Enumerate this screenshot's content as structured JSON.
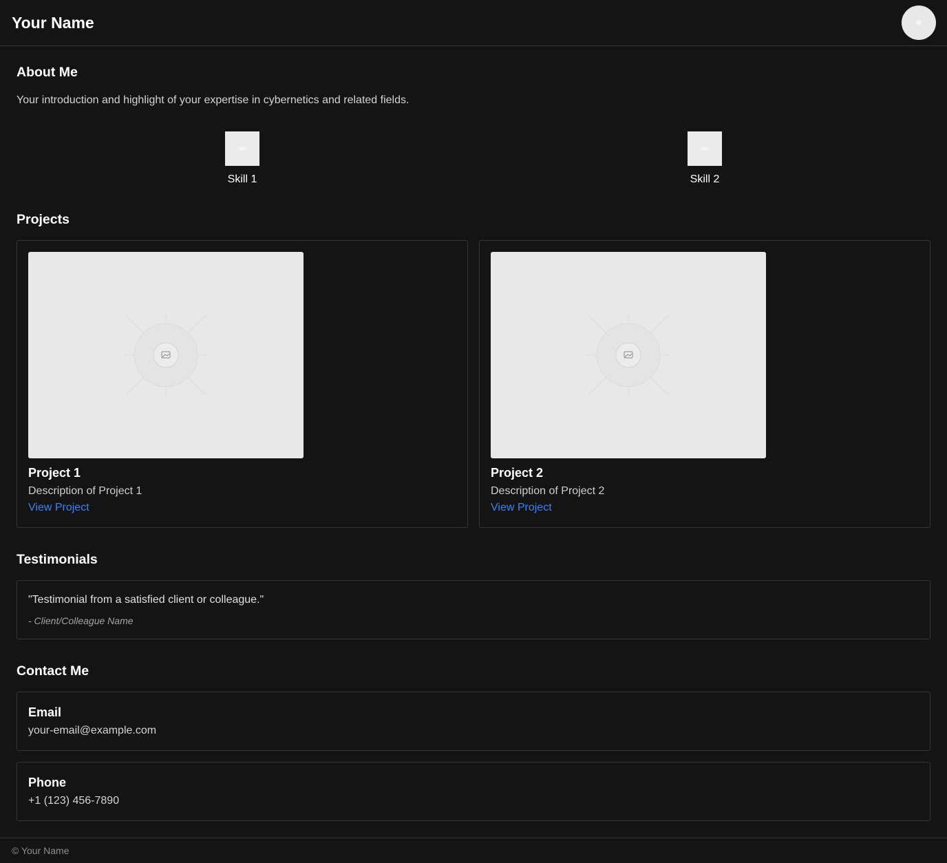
{
  "header": {
    "title": "Your Name"
  },
  "about": {
    "heading": "About Me",
    "text": "Your introduction and highlight of your expertise in cybernetics and related fields.",
    "skills": [
      {
        "label": "Skill 1"
      },
      {
        "label": "Skill 2"
      }
    ]
  },
  "projects": {
    "heading": "Projects",
    "items": [
      {
        "title": "Project 1",
        "description": "Description of Project 1",
        "link_label": "View Project"
      },
      {
        "title": "Project 2",
        "description": "Description of Project 2",
        "link_label": "View Project"
      }
    ]
  },
  "testimonials": {
    "heading": "Testimonials",
    "quote": "\"Testimonial from a satisfied client or colleague.\"",
    "author": "- Client/Colleague Name"
  },
  "contact": {
    "heading": "Contact Me",
    "email": {
      "label": "Email",
      "value": "your-email@example.com"
    },
    "phone": {
      "label": "Phone",
      "value": "+1 (123) 456-7890"
    }
  },
  "footer": {
    "text": "© Your Name"
  },
  "colors": {
    "background": "#141415",
    "border": "#34353a",
    "link": "#3b82f6",
    "placeholder": "#e8e8e8"
  }
}
